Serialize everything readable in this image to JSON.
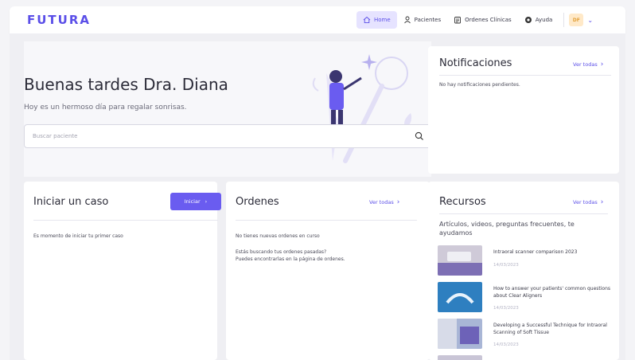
{
  "brand": {
    "logo": "FUTURA",
    "accent": "#5b4fe8"
  },
  "nav": {
    "home": "Home",
    "patients": "Pacientes",
    "clinical_orders": "Ordenes Clínicas",
    "help": "Ayuda",
    "avatar_initials": "DF"
  },
  "hero": {
    "greeting": "Buenas tardes Dra. Diana",
    "subtitle": "Hoy es un hermoso día para regalar sonrisas.",
    "search_placeholder": "Buscar paciente"
  },
  "notifications": {
    "title": "Notificaciones",
    "see_all": "Ver todas",
    "empty": "No hay notificaciones pendientes."
  },
  "start_case": {
    "title": "Iniciar un caso",
    "button": "Iniciar",
    "message": "Es momento de iniciar tu primer caso"
  },
  "orders": {
    "title": "Ordenes",
    "see_all": "Ver todas",
    "empty": "No tienes nuevas ordenes en curso",
    "past_line1": "Estás buscando tus ordenes pasadas?",
    "past_line2": "Puedes encontrarlas en la página de ordenes."
  },
  "resources": {
    "title": "Recursos",
    "see_all": "Ver todas",
    "subtitle": "Artículos, videos, preguntas frecuentes, te ayudamos",
    "items": [
      {
        "title": "Intraoral scanner comparison 2023",
        "date": "14/03/2023"
      },
      {
        "title": "How to answer your patients' common questions about Clear Aligners",
        "date": "14/03/2023"
      },
      {
        "title": "Developing a Successful Technique for Intraoral Scanning of Soft Tissue",
        "date": "14/03/2023"
      }
    ]
  }
}
